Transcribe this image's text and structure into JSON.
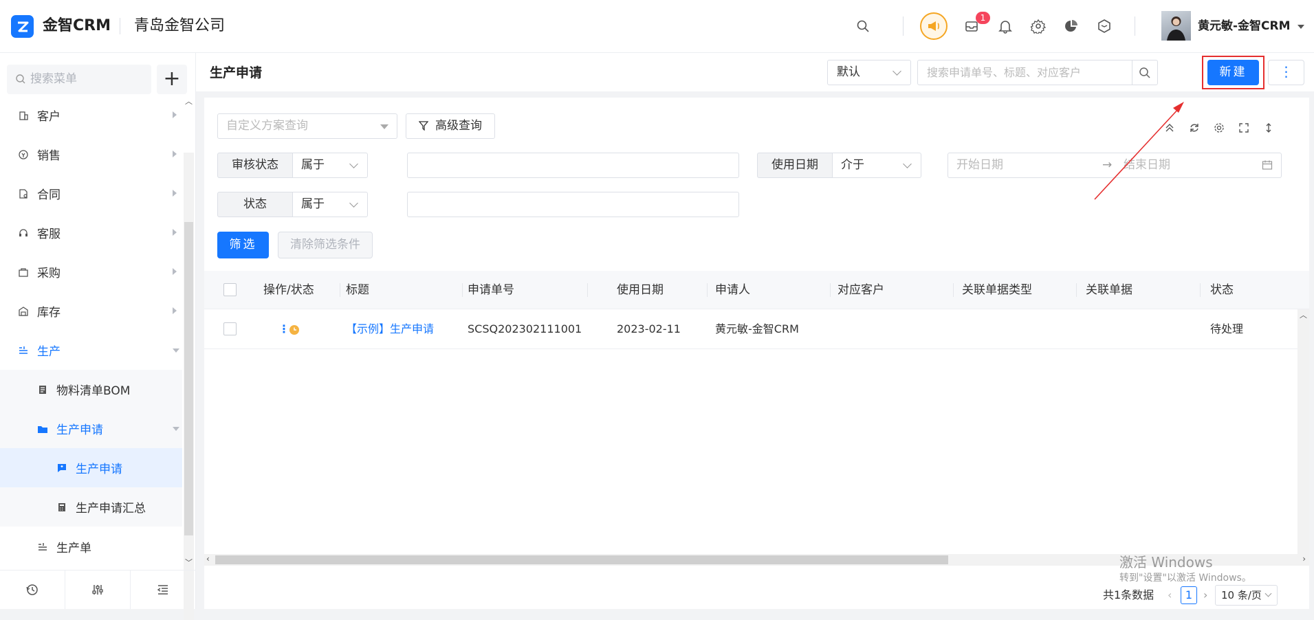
{
  "app": {
    "brand": "金智CRM",
    "company": "青岛金智公司"
  },
  "header": {
    "notification_count": "1",
    "user_name": "黄元敏-金智CRM"
  },
  "sidebar": {
    "search_placeholder": "搜索菜单",
    "add_label": "+",
    "items": [
      {
        "label": "客户",
        "icon": "building-icon"
      },
      {
        "label": "销售",
        "icon": "sales-icon"
      },
      {
        "label": "合同",
        "icon": "contract-icon"
      },
      {
        "label": "客服",
        "icon": "headset-icon"
      },
      {
        "label": "采购",
        "icon": "bag-icon"
      },
      {
        "label": "库存",
        "icon": "warehouse-icon"
      },
      {
        "label": "生产",
        "icon": "production-icon"
      },
      {
        "label": "物料清单BOM",
        "icon": "document-icon"
      },
      {
        "label": "生产申请",
        "icon": "folder-icon"
      },
      {
        "label": "生产申请",
        "icon": "request-icon"
      },
      {
        "label": "生产申请汇总",
        "icon": "calculator-icon"
      },
      {
        "label": "生产单",
        "icon": "production-icon"
      }
    ]
  },
  "page": {
    "title": "生产申请",
    "view_select": "默认",
    "search_placeholder": "搜索申请单号、标题、对应客户",
    "new_button": "新建",
    "more_button": "⋮"
  },
  "filters": {
    "scheme_placeholder": "自定义方案查询",
    "advanced_query": "高级查询",
    "review_status_label": "审核状态",
    "review_status_op": "属于",
    "use_date_label": "使用日期",
    "use_date_op": "介于",
    "start_date_placeholder": "开始日期",
    "end_date_placeholder": "结束日期",
    "status_label": "状态",
    "status_op": "属于",
    "filter_button": "筛选",
    "clear_button": "清除筛选条件"
  },
  "table": {
    "columns": [
      "操作/状态",
      "标题",
      "申请单号",
      "使用日期",
      "申请人",
      "对应客户",
      "关联单据类型",
      "关联单据",
      "状态"
    ],
    "rows": [
      {
        "action": "⋮",
        "title": "【示例】生产申请",
        "number": "SCSQ202302111001",
        "date": "2023-02-11",
        "applicant": "黄元敏-金智CRM",
        "customer": "",
        "link_type": "",
        "link_doc": "",
        "status": "待处理"
      }
    ]
  },
  "pagination": {
    "total": "共1条数据",
    "current_page": "1",
    "page_size": "10 条/页"
  },
  "watermark": {
    "line1": "激活 Windows",
    "line2": "转到\"设置\"以激活 Windows。"
  },
  "colors": {
    "primary": "#1677ff",
    "highlight_frame": "#e52e2e",
    "badge": "#f5455c",
    "notice": "#f5a623"
  }
}
